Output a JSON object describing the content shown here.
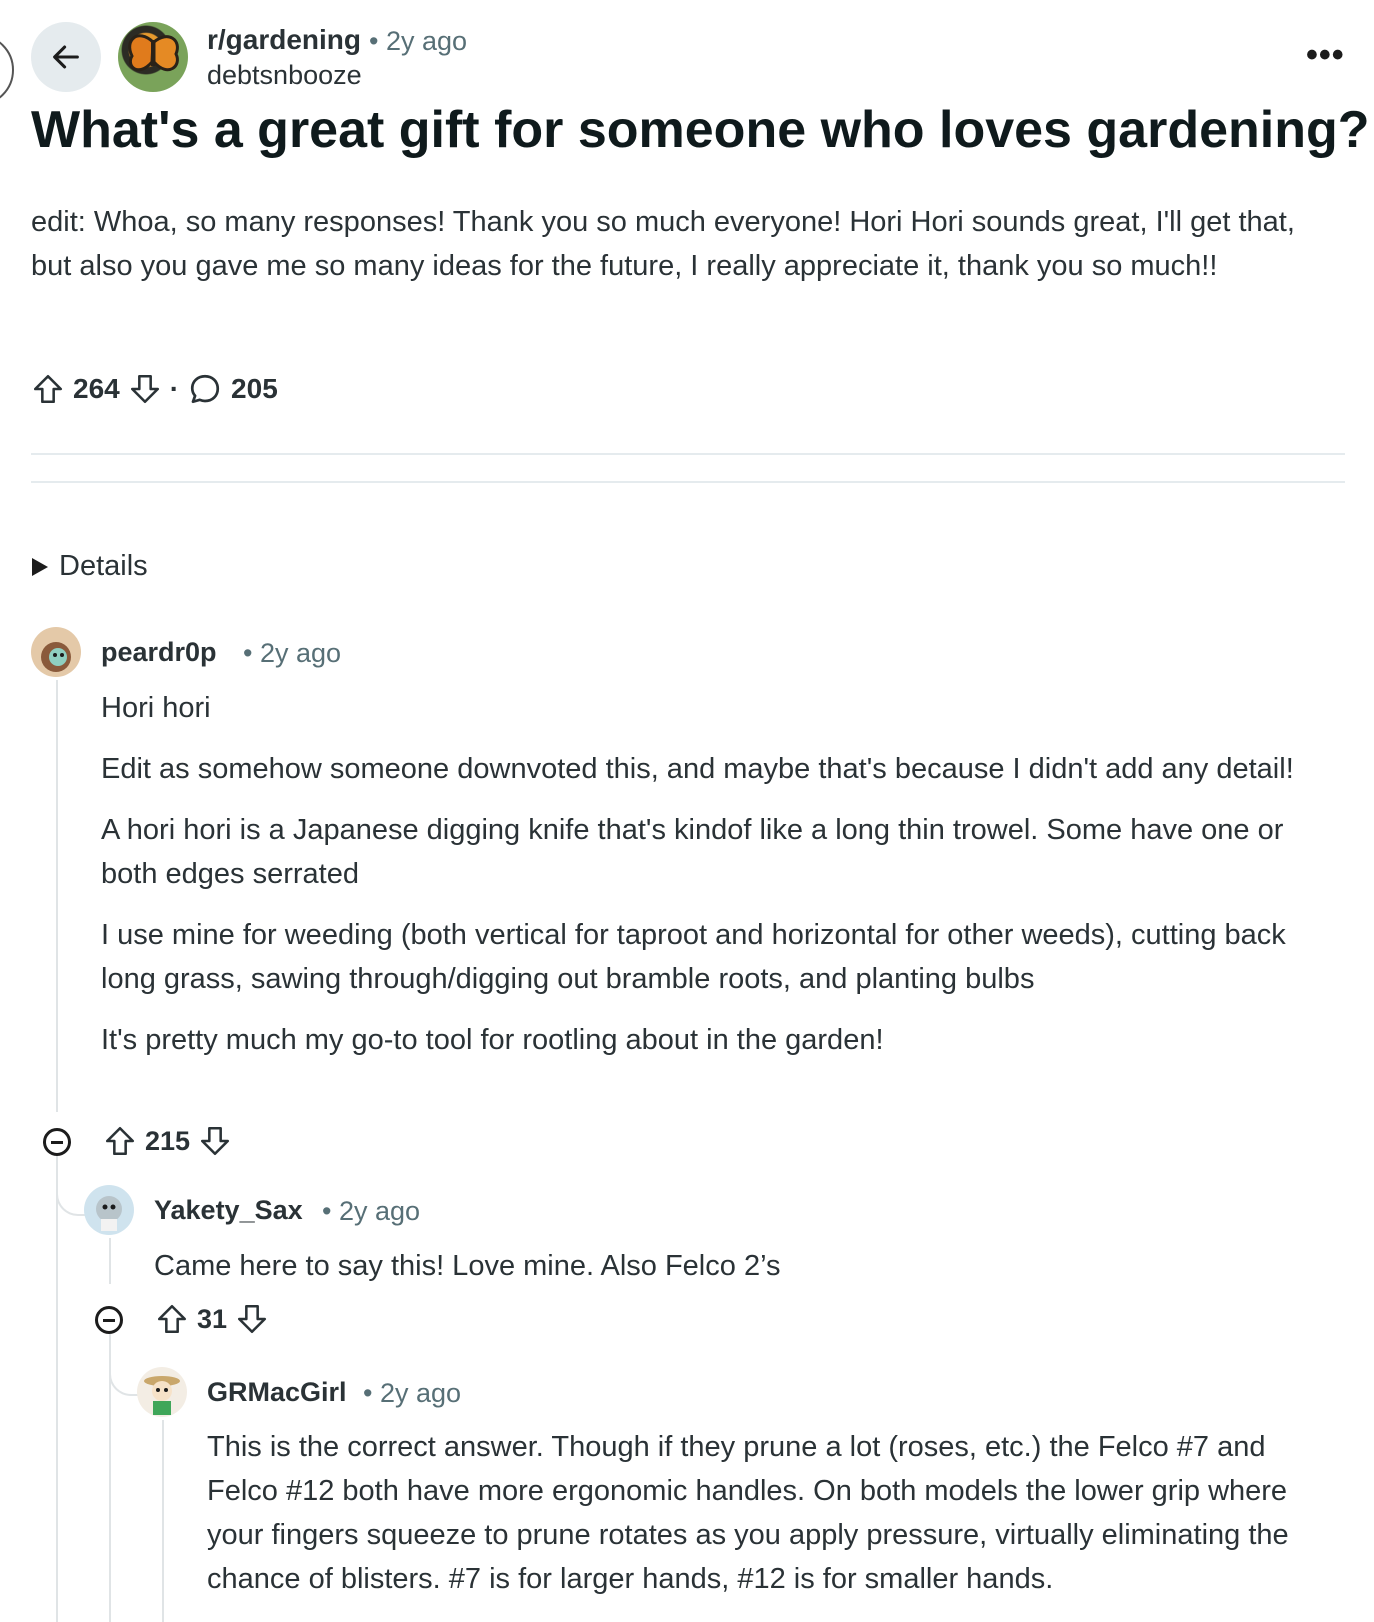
{
  "header": {
    "subreddit": "r/gardening",
    "time": "• 2y ago",
    "author": "debtsnbooze",
    "more": "•••"
  },
  "post": {
    "title": "What's a great gift for someone who loves gardening?",
    "body": "edit: Whoa, so many responses! Thank you so much everyone! Hori Hori sounds great, I'll get that, but also you gave me so many ideas for the future, I really appreciate it, thank you so much!!",
    "score": "264",
    "dot": "·",
    "comments": "205"
  },
  "details_label": "Details",
  "comments": [
    {
      "author": "peardr0p",
      "time": "• 2y ago",
      "paragraphs": [
        "Hori hori",
        "Edit as somehow someone downvoted this, and maybe that's because I didn't add any detail!",
        "A hori hori is a Japanese digging knife that's kindof like a long thin trowel. Some have one or both edges serrated",
        "I use mine for weeding (both vertical for taproot and horizontal for other weeds), cutting back long grass, sawing through/digging out bramble roots, and planting bulbs",
        "It's pretty much my go-to tool for rootling about in the garden!"
      ],
      "score": "215"
    },
    {
      "author": "Yakety_Sax",
      "time": "• 2y ago",
      "paragraphs": [
        "Came here to say this! Love mine. Also Felco 2’s"
      ],
      "score": "31"
    },
    {
      "author": "GRMacGirl",
      "time": "• 2y ago",
      "paragraphs": [
        "This is the correct answer. Though if they prune a lot (roses, etc.) the Felco #7 and Felco #12 both have more ergonomic handles. On both models the lower grip where your fingers squeeze to prune rotates as you apply pressure, virtually eliminating the chance of blisters. #7 is for larger hands, #12 is for smaller hands."
      ]
    }
  ]
}
